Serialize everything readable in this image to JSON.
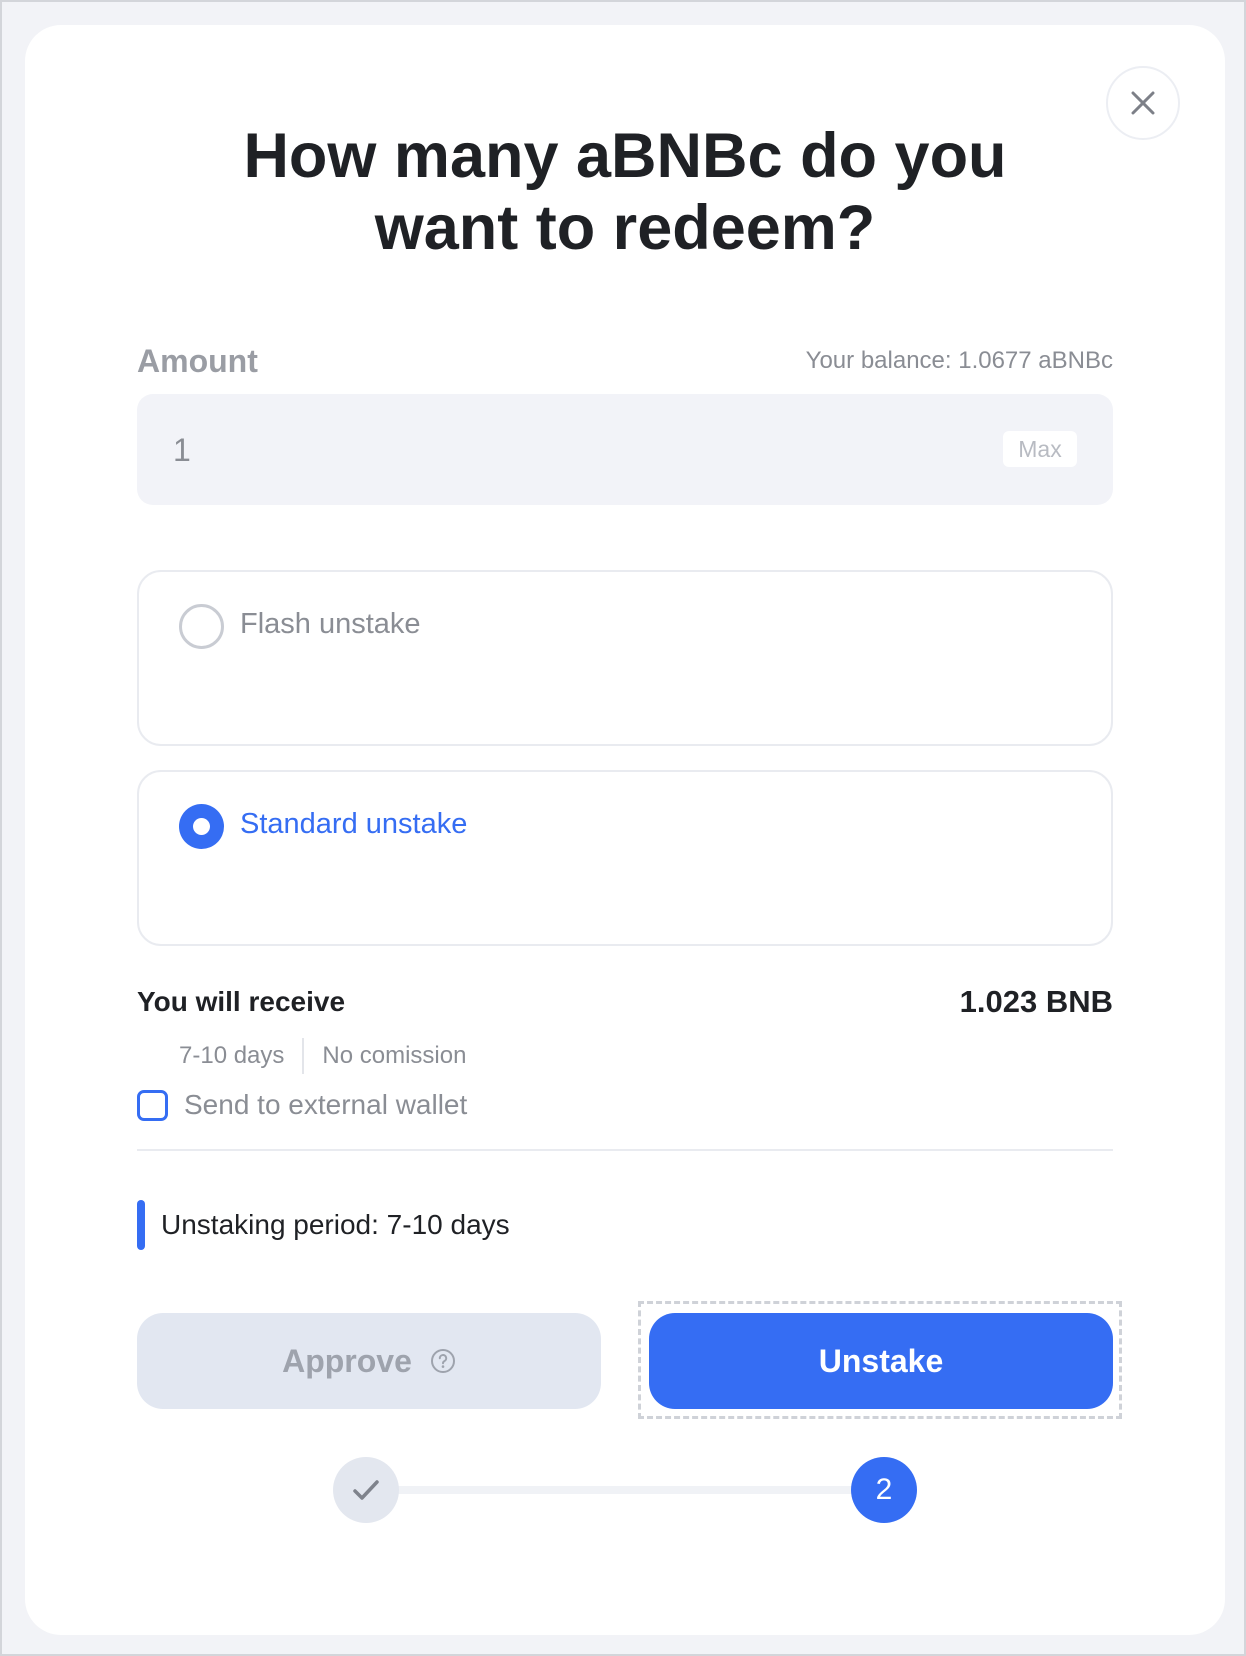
{
  "modal": {
    "title_line1": "How many aBNBc do you",
    "title_line2": "want to redeem?",
    "close_icon": "close-icon"
  },
  "amount": {
    "label": "Amount",
    "balance_text": "Your balance: 1.0677 aBNBc",
    "input_value": "1",
    "max_label": "Max"
  },
  "options": [
    {
      "label": "Flash unstake",
      "selected": false
    },
    {
      "label": "Standard unstake",
      "selected": true
    }
  ],
  "receive": {
    "label": "You will receive",
    "value": "1.023 BNB",
    "duration": "7-10 days",
    "commission": "No comission"
  },
  "external_wallet": {
    "label": "Send to external wallet",
    "checked": false
  },
  "period": {
    "text": "Unstaking period: 7-10 days"
  },
  "buttons": {
    "approve_label": "Approve",
    "approve_help_icon": "help-circle-icon",
    "unstake_label": "Unstake"
  },
  "stepper": {
    "step1_icon": "check-icon",
    "step2_label": "2"
  },
  "colors": {
    "accent": "#356df3",
    "text_primary": "#1f2125",
    "text_muted": "#8a8d94",
    "disabled_bg": "#e2e7f1"
  }
}
